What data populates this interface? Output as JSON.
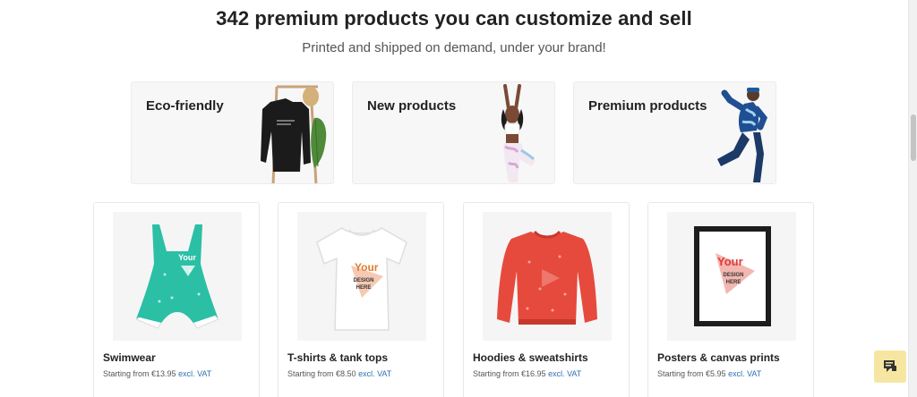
{
  "header": {
    "title": "342 premium products you can customize and sell",
    "subtitle": "Printed and shipped on demand, under your brand!"
  },
  "categories": [
    {
      "label": "Eco-friendly",
      "icon": "sweatshirt-on-rack-icon"
    },
    {
      "label": "New products",
      "icon": "yoga-model-icon"
    },
    {
      "label": "Premium products",
      "icon": "jumping-model-icon"
    }
  ],
  "products": [
    {
      "name": "Swimwear",
      "price_prefix": "Starting from ",
      "price": "€13.95",
      "vat": "excl. VAT",
      "color": "#2bbfa6",
      "icon": "swimsuit-icon"
    },
    {
      "name": "T-shirts & tank tops",
      "price_prefix": "Starting from ",
      "price": "€8.50",
      "vat": "excl. VAT",
      "color": "#ffffff",
      "icon": "tshirt-icon"
    },
    {
      "name": "Hoodies & sweatshirts",
      "price_prefix": "Starting from ",
      "price": "€16.95",
      "vat": "excl. VAT",
      "color": "#e64a3c",
      "icon": "sweatshirt-icon"
    },
    {
      "name": "Posters & canvas prints",
      "price_prefix": "Starting from ",
      "price": "€5.95",
      "vat": "excl. VAT",
      "color": "#222222",
      "icon": "poster-frame-icon"
    }
  ],
  "design_mark": {
    "line1": "Your",
    "line2": "DESIGN",
    "line3": "HERE"
  },
  "colors": {
    "accent_link": "#2f6fb3",
    "chat_button": "#f6e6a2",
    "card_bg": "#f7f7f7"
  },
  "chat": {
    "icon": "chat-bubble-icon"
  }
}
